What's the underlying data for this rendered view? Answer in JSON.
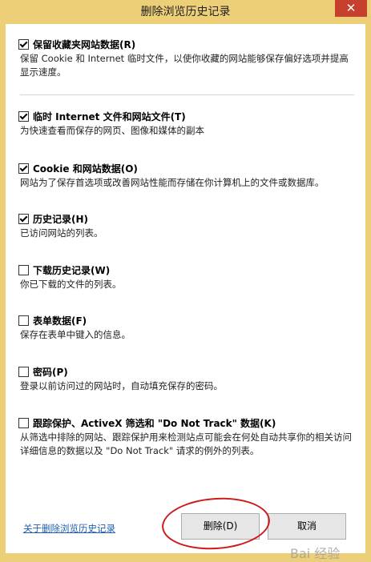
{
  "window": {
    "title": "删除浏览历史记录",
    "close_glyph": "✕"
  },
  "options": [
    {
      "label": "保留收藏夹网站数据(R)",
      "checked": true,
      "description": "保留 Cookie 和 Internet 临时文件，以使你收藏的网站能够保存偏好选项并提高显示速度。"
    },
    {
      "label": "临时 Internet 文件和网站文件(T)",
      "checked": true,
      "description": "为快速查看而保存的网页、图像和媒体的副本"
    },
    {
      "label": "Cookie 和网站数据(O)",
      "checked": true,
      "description": "网站为了保存首选项或改善网站性能而存储在你计算机上的文件或数据库。"
    },
    {
      "label": "历史记录(H)",
      "checked": true,
      "description": "已访问网站的列表。"
    },
    {
      "label": "下载历史记录(W)",
      "checked": false,
      "description": "你已下载的文件的列表。"
    },
    {
      "label": "表单数据(F)",
      "checked": false,
      "description": "保存在表单中键入的信息。"
    },
    {
      "label": "密码(P)",
      "checked": false,
      "description": "登录以前访问过的网站时，自动填充保存的密码。"
    },
    {
      "label": "跟踪保护、ActiveX 筛选和 \"Do Not Track\" 数据(K)",
      "checked": false,
      "description": "从筛选中排除的网站、跟踪保护用来检测站点可能会在何处自动共享你的相关访问详细信息的数据以及 \"Do Not Track\" 请求的例外的列表。"
    }
  ],
  "footer": {
    "about_link": "关于删除浏览历史记录",
    "delete_button": "删除(D)",
    "cancel_button": "取消"
  },
  "watermark": "Bai 经验",
  "colors": {
    "title_bar": "#edcf78",
    "close_button": "#c7402d",
    "link": "#1f5fae",
    "annotation": "#cc1b1b"
  }
}
